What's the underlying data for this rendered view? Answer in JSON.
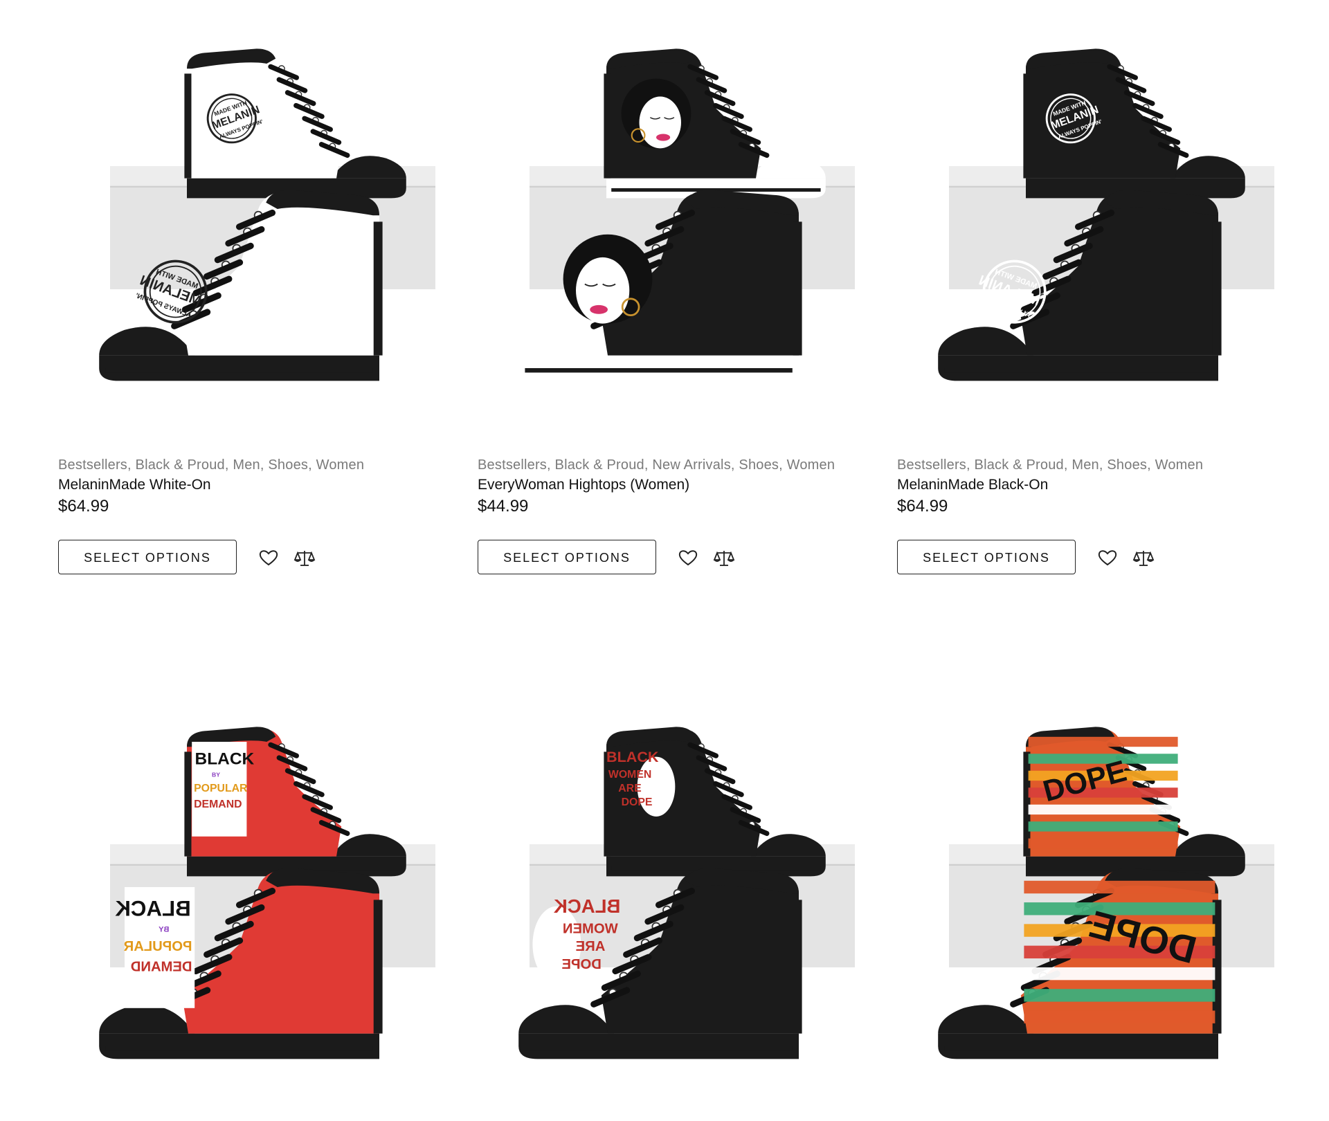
{
  "products": [
    {
      "categories": "Bestsellers, Black & Proud, Men, Shoes, Women",
      "title": "MelaninMade White-On",
      "price": "$64.99",
      "select_label": "SELECT OPTIONS",
      "wishlist_icon": "heart-icon",
      "compare_icon": "scale-icon",
      "design": "white",
      "print_text": [
        "MADE WITH",
        "MELANIN",
        "ALWAYS POPPIN'"
      ]
    },
    {
      "categories": "Bestsellers, Black & Proud, New Arrivals, Shoes, Women",
      "title": "EveryWoman Hightops (Women)",
      "price": "$44.99",
      "select_label": "SELECT OPTIONS",
      "wishlist_icon": "heart-icon",
      "compare_icon": "scale-icon",
      "design": "afro-woman"
    },
    {
      "categories": "Bestsellers, Black & Proud, Men, Shoes, Women",
      "title": "MelaninMade Black-On",
      "price": "$64.99",
      "select_label": "SELECT OPTIONS",
      "wishlist_icon": "heart-icon",
      "compare_icon": "scale-icon",
      "design": "black",
      "print_text": [
        "MADE WITH",
        "MELANIN",
        "ALWAYS POPPIN'"
      ]
    },
    {
      "design": "red",
      "print_text": [
        "BLACK",
        "BY",
        "POPULAR",
        "DEMAND"
      ]
    },
    {
      "design": "black-women",
      "print_text": [
        "BLACK",
        "WOMEN",
        "ARE",
        "DOPE"
      ]
    },
    {
      "design": "stripes",
      "print_text": [
        "DOPE"
      ]
    }
  ],
  "colors": {
    "red": "#e03a34",
    "shoe_black": "#1b1b1b",
    "box_gray": "#e4e4e4",
    "lip_pink": "#d7336b",
    "hoop_gold": "#c8922e"
  }
}
